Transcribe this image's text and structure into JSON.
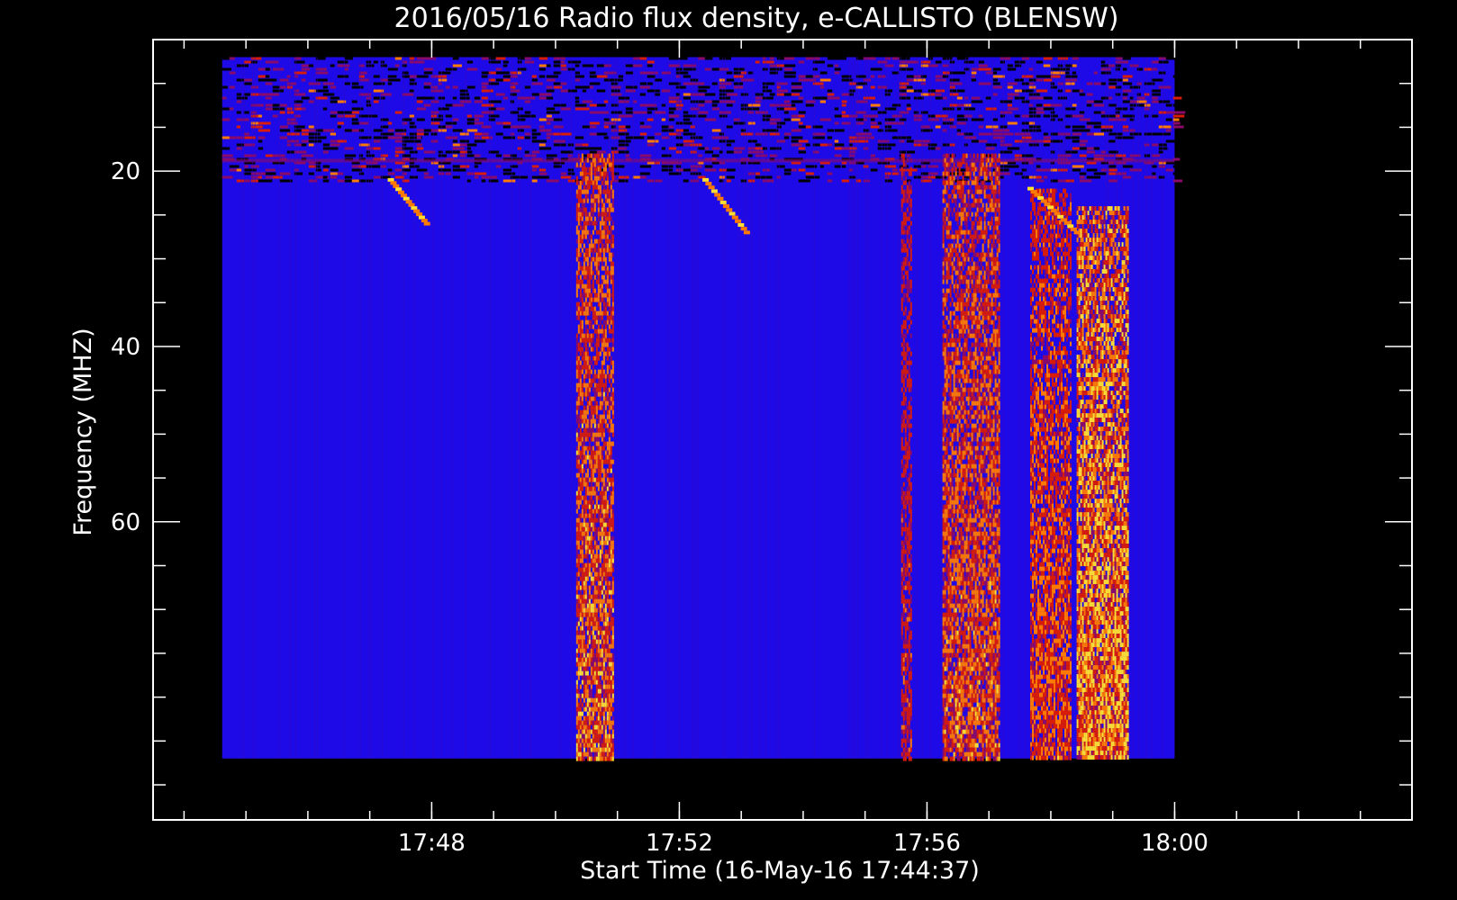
{
  "chart_data": {
    "type": "heatmap",
    "title": "2016/05/16  Radio flux density, e-CALLISTO (BLENSW)",
    "xlabel": "Start Time (16-May-16 17:44:37)",
    "ylabel": "Frequency (MHZ)",
    "x_unit": "UT time",
    "x_data_range": [
      "17:44:37",
      "18:00:00"
    ],
    "x_axis_range": [
      "17:43:30",
      "18:03:50"
    ],
    "x_major_ticks": [
      "17:48",
      "17:52",
      "17:56",
      "18:00"
    ],
    "x_minor_tick_step_minutes": 1,
    "y_axis_range": [
      5,
      94
    ],
    "y_data_range": [
      7,
      87
    ],
    "y_inverted": true,
    "y_major_ticks": [
      20,
      40,
      60
    ],
    "y_minor_tick_step": 5,
    "colormap": [
      "#000000",
      "#1a0ad6",
      "#2a00ff",
      "#8a0a6a",
      "#d81c08",
      "#ff7a00",
      "#ffe030"
    ],
    "background_color": "#1e0ae6",
    "features": [
      {
        "kind": "broadband burst",
        "start": "17:50:20",
        "end": "17:50:55",
        "freq_range": [
          18,
          87
        ],
        "intensity": 0.8
      },
      {
        "kind": "broadband burst",
        "start": "17:55:35",
        "end": "17:55:45",
        "freq_range": [
          18,
          87
        ],
        "intensity": 0.55
      },
      {
        "kind": "broadband burst",
        "start": "17:56:15",
        "end": "17:57:10",
        "freq_range": [
          18,
          87
        ],
        "intensity": 0.75
      },
      {
        "kind": "broadband burst",
        "start": "17:57:40",
        "end": "17:58:20",
        "freq_range": [
          22,
          87
        ],
        "intensity": 0.7
      },
      {
        "kind": "broadband burst",
        "start": "17:58:25",
        "end": "17:59:15",
        "freq_range": [
          24,
          87
        ],
        "intensity": 1.0
      },
      {
        "kind": "drifting burst",
        "start": "17:47:20",
        "end": "17:47:55",
        "freq_range": [
          21,
          26
        ]
      },
      {
        "kind": "drifting burst",
        "start": "17:52:25",
        "end": "17:53:05",
        "freq_range": [
          21,
          27
        ]
      },
      {
        "kind": "drifting burst",
        "start": "17:57:40",
        "end": "17:58:25",
        "freq_range": [
          22,
          27
        ]
      }
    ]
  }
}
